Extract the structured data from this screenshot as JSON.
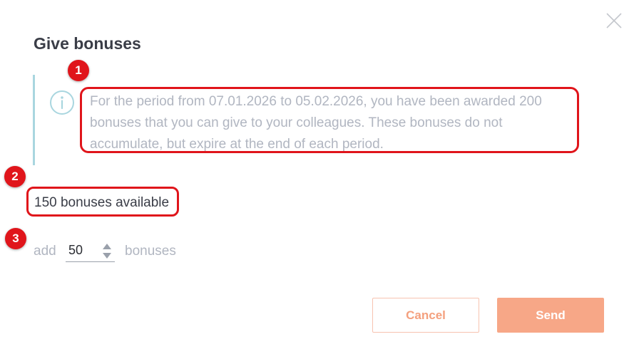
{
  "dialog": {
    "title": "Give bonuses",
    "info_text": "For the period from 07.01.2026 to 05.02.2026, you have been awarded 200 bonuses that you can give to your colleagues. These bonuses do not accumulate, but expire at the end of each period.",
    "available_text": "150 bonuses available",
    "add_label": "add",
    "quantity_value": "50",
    "bonuses_label": "bonuses",
    "cancel_label": "Cancel",
    "send_label": "Send"
  },
  "annotations": {
    "badge_1": "1",
    "badge_2": "2",
    "badge_3": "3"
  },
  "icons": {
    "close": "close-icon",
    "info": "info-icon",
    "stepper_up": "chevron-up-icon",
    "stepper_down": "chevron-down-icon"
  },
  "colors": {
    "accent": "#f7a787",
    "annotation": "#e0151b",
    "info_bar": "#a9d6df",
    "muted_text": "#b1b6c1",
    "title_text": "#3a3d47"
  }
}
